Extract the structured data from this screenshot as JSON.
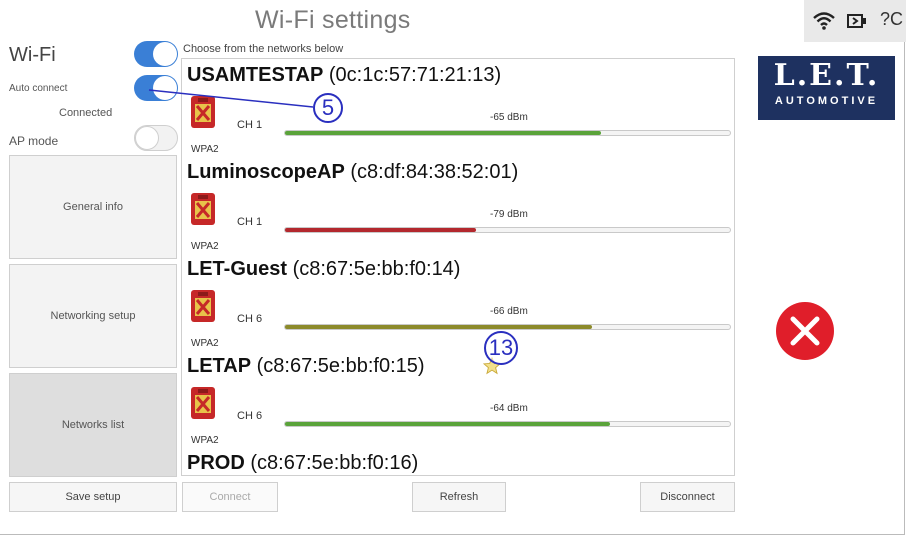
{
  "header": {
    "title": "Wi-Fi settings",
    "status_text": "?C"
  },
  "sidebar": {
    "wifi_label": "Wi-Fi",
    "wifi_toggle": "on",
    "auto_connect_label": "Auto connect",
    "auto_connect_toggle": "on",
    "connection_status": "Connected",
    "ap_mode_label": "AP mode",
    "ap_mode_toggle": "off",
    "buttons": [
      {
        "label": "General info"
      },
      {
        "label": "Networking setup"
      },
      {
        "label": "Networks list",
        "active": true
      }
    ],
    "save_label": "Save setup"
  },
  "main": {
    "instruction": "Choose from the networks below",
    "networks": [
      {
        "ssid": "USAMTESTAP",
        "mac": "(0c:1c:57:71:21:13)",
        "channel": "CH  1",
        "encryption": "WPA2",
        "signal": "-65 dBm",
        "signal_fraction": 0.71,
        "bar_color": "#5aa33a"
      },
      {
        "ssid": "LuminoscopeAP",
        "mac": "(c8:df:84:38:52:01)",
        "channel": "CH  1",
        "encryption": "WPA2",
        "signal": "-79 dBm",
        "signal_fraction": 0.43,
        "bar_color": "#b3282d"
      },
      {
        "ssid": "LET-Guest",
        "mac": "(c8:67:5e:bb:f0:14)",
        "channel": "CH  6",
        "encryption": "WPA2",
        "signal": "-66 dBm",
        "signal_fraction": 0.69,
        "bar_color": "#8c8a2a"
      },
      {
        "ssid": "LETAP",
        "mac": "(c8:67:5e:bb:f0:15)",
        "channel": "CH  6",
        "encryption": "WPA2",
        "signal": "-64 dBm",
        "signal_fraction": 0.73,
        "bar_color": "#5aa33a",
        "favorite": true
      },
      {
        "ssid": "PROD",
        "mac": "(c8:67:5e:bb:f0:16)"
      }
    ],
    "buttons": {
      "connect": "Connect",
      "refresh": "Refresh",
      "disconnect": "Disconnect"
    }
  },
  "logo": {
    "top": "L.E.T.",
    "bottom": "AUTOMOTIVE"
  },
  "callouts": {
    "auto_connect": "5",
    "favorite": "13"
  },
  "colors": {
    "accent": "#3a7fd6",
    "close": "#e01e2a",
    "logo_bg": "#1e3160",
    "callout": "#2a2fbf"
  }
}
